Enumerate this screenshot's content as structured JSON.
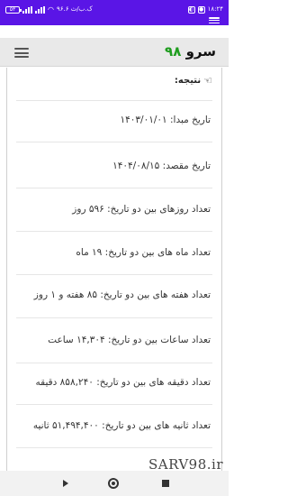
{
  "status_bar": {
    "time": "۱۸:۲۴",
    "battery": "۵۳",
    "speed": "۹۶.۶ ک.ب/ث"
  },
  "header": {
    "logo_text": "سرو",
    "logo_number": "۹۸"
  },
  "result": {
    "title": "نتیجه:",
    "rows": [
      "تاریخ مبدا: ۱۴۰۳/۰۱/۰۱",
      "تاریخ مقصد: ۱۴۰۴/۰۸/۱۵",
      "تعداد روزهای بین دو تاریخ: ۵۹۶ روز",
      "تعداد ماه های بین دو تاریخ: ۱۹ ماه",
      "تعداد هفته های بین دو تاریخ: ۸۵ هفته و ۱ روز",
      "تعداد ساعات بین دو تاریخ: ۱۴,۳۰۴ ساعت",
      "تعداد دقیقه های بین دو تاریخ: ۸۵۸,۲۴۰ دقیقه",
      "تعداد ثانیه های بین دو تاریخ: ۵۱,۴۹۴,۴۰۰ ثانیه"
    ]
  },
  "watermark": "SARV98.ir"
}
